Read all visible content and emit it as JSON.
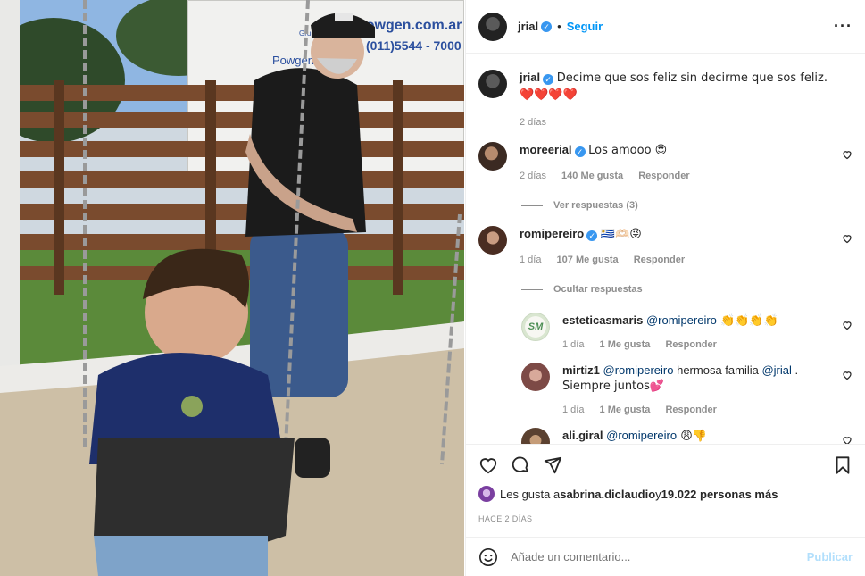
{
  "post": {
    "author": "jrial",
    "follow_label": "Seguir",
    "more_icon": "more-options-icon",
    "caption": "Decime que sos feliz sin decirme que sos feliz. ❤️❤️❤️❤️",
    "caption_time": "2 días",
    "photo_sign": {
      "brand": "powgen.com.ar",
      "phone": "(011)5544 - 7000",
      "small": "Grupos Electrógenos",
      "side": "Powgen"
    }
  },
  "comments": [
    {
      "user": "moreerial",
      "text": "Los amooo 😍",
      "time": "2 días",
      "likes": "140 Me gusta",
      "reply": "Responder",
      "replies_toggle": "Ver respuestas (3)"
    },
    {
      "user": "romipereiro",
      "text": "🇺🇾🫶🏻😜",
      "time": "1 día",
      "likes": "107 Me gusta",
      "reply": "Responder",
      "replies_toggle": "Ocultar respuestas"
    }
  ],
  "replies": [
    {
      "user": "esteticasmaris",
      "mention": "@romipereiro",
      "text": " 👏👏👏👏",
      "time": "1 día",
      "likes": "1 Me gusta",
      "reply": "Responder",
      "avatar_text": "SM"
    },
    {
      "user": "mirtiz1",
      "mention": "@romipereiro",
      "text_mid": " hermosa familia ",
      "mention2": "@jrial",
      "text_end": " .",
      "line2": "Siempre juntos💕",
      "time": "1 día",
      "likes": "1 Me gusta",
      "reply": "Responder"
    },
    {
      "user": "ali.giral",
      "mention": "@romipereiro",
      "text": " 😩👎"
    }
  ],
  "likes_line": {
    "prefix": "Les gusta a ",
    "user": "sabrina.diclaudio",
    "middle": " y ",
    "count": "19.022 personas más"
  },
  "posted_ago": "HACE 2 DÍAS",
  "comment_box": {
    "placeholder": "Añade un comentario...",
    "publish_label": "Publicar"
  },
  "colors": {
    "accent": "#0095f6",
    "publish_disabled": "#b2dffc",
    "meta": "#8e8e8e",
    "verified": "#3897f0"
  }
}
